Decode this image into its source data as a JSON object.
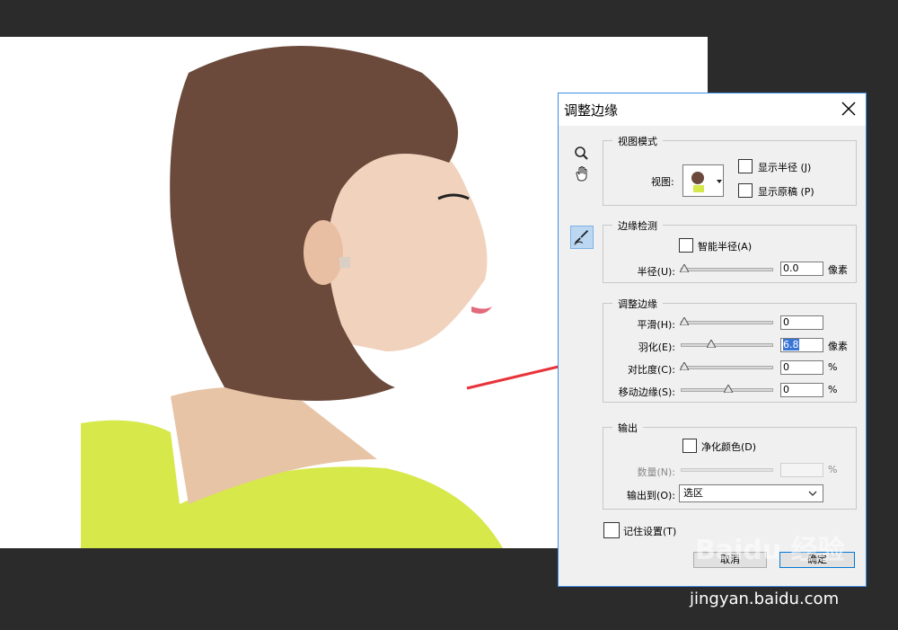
{
  "dialog": {
    "title": "调整边缘",
    "view_mode": {
      "legend": "视图模式",
      "view_label": "视图:",
      "show_radius": "显示半径 (J)",
      "show_original": "显示原稿 (P)"
    },
    "edge_detection": {
      "legend": "边缘检测",
      "smart_radius": "智能半径(A)",
      "radius_label": "半径(U):",
      "radius_value": "0.0",
      "radius_unit": "像素"
    },
    "adjust_edge": {
      "legend": "调整边缘",
      "smooth_label": "平滑(H):",
      "smooth_value": "0",
      "feather_label": "羽化(E):",
      "feather_value": "6.8",
      "feather_unit": "像素",
      "contrast_label": "对比度(C):",
      "contrast_value": "0",
      "contrast_unit": "%",
      "shift_label": "移动边缘(S):",
      "shift_value": "0",
      "shift_unit": "%"
    },
    "output": {
      "legend": "输出",
      "decontaminate": "净化颜色(D)",
      "amount_label": "数量(N):",
      "amount_unit": "%",
      "output_to_label": "输出到(O):",
      "output_to_value": "选区"
    },
    "remember": "记住设置(T)",
    "cancel": "取消",
    "ok": "确定"
  },
  "watermark": {
    "brand": "Baidu 经验",
    "url": "jingyan.baidu.com"
  },
  "colors": {
    "accent": "#3a8ee6",
    "arrow": "#e8333a"
  }
}
